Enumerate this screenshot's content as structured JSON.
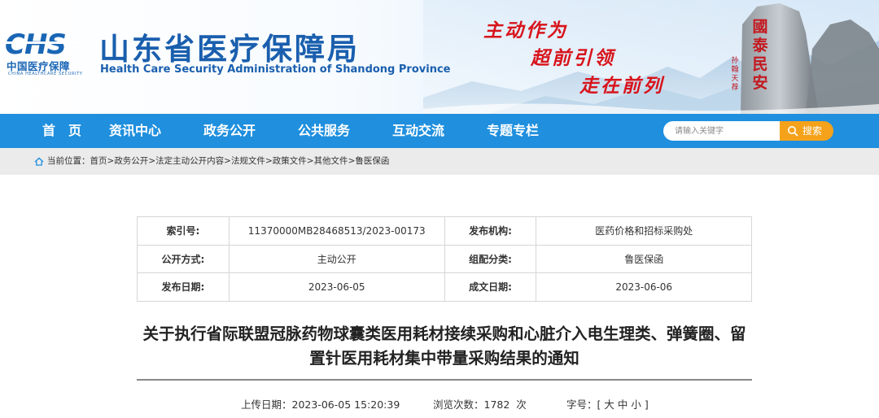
{
  "header": {
    "logo_mark": "CHS",
    "logo_cn": "中国医疗保障",
    "logo_en": "CHINA HEALTHCARE SECURITY",
    "title": "山东省医疗保障局",
    "subtitle": "Health Care Security Administration of Shandong Province",
    "slogans": [
      "主动作为",
      "超前引领",
      "走在前列"
    ],
    "rock_text": [
      "國泰民安",
      "孙翰天荐"
    ]
  },
  "nav": {
    "items": [
      "首　页",
      "资讯中心",
      "政务公开",
      "公共服务",
      "互动交流",
      "专题专栏"
    ],
    "search_placeholder": "请输入关键字",
    "search_label": "搜索"
  },
  "breadcrumb": {
    "prefix": "当前位置：",
    "items": [
      "首页",
      "政务公开",
      "法定主动公开内容",
      "法规文件",
      "政策文件",
      "其他文件",
      "鲁医保函"
    ],
    "separator": ">"
  },
  "meta": {
    "rows": [
      [
        {
          "k": "索引号:",
          "v": "11370000MB28468513/2023-00173"
        },
        {
          "k": "发布机构:",
          "v": "医药价格和招标采购处"
        }
      ],
      [
        {
          "k": "公开方式:",
          "v": "主动公开"
        },
        {
          "k": "组配分类:",
          "v": "鲁医保函"
        }
      ],
      [
        {
          "k": "发布日期:",
          "v": "2023-06-05"
        },
        {
          "k": "成文日期:",
          "v": "2023-06-06"
        }
      ]
    ]
  },
  "article": {
    "title": "关于执行省际联盟冠脉药物球囊类医用耗材接续采购和心脏介入电生理类、弹簧圈、留置针医用耗材集中带量采购结果的通知",
    "upload_label": "上传日期：",
    "upload_value": "2023-06-05 15:20:39",
    "views_label": "浏览次数：",
    "views_value": "1782",
    "views_unit": "次",
    "font_label": "字号：",
    "font_open": "[",
    "font_sizes": [
      "大",
      "中",
      "小"
    ],
    "font_close": "]"
  },
  "colors": {
    "nav_bg": "#1f8fde",
    "title_blue": "#1a5fae",
    "slogan_red": "#d8141c",
    "search_btn": "#f5a21b",
    "breadcrumb_bg": "#ebebeb"
  }
}
